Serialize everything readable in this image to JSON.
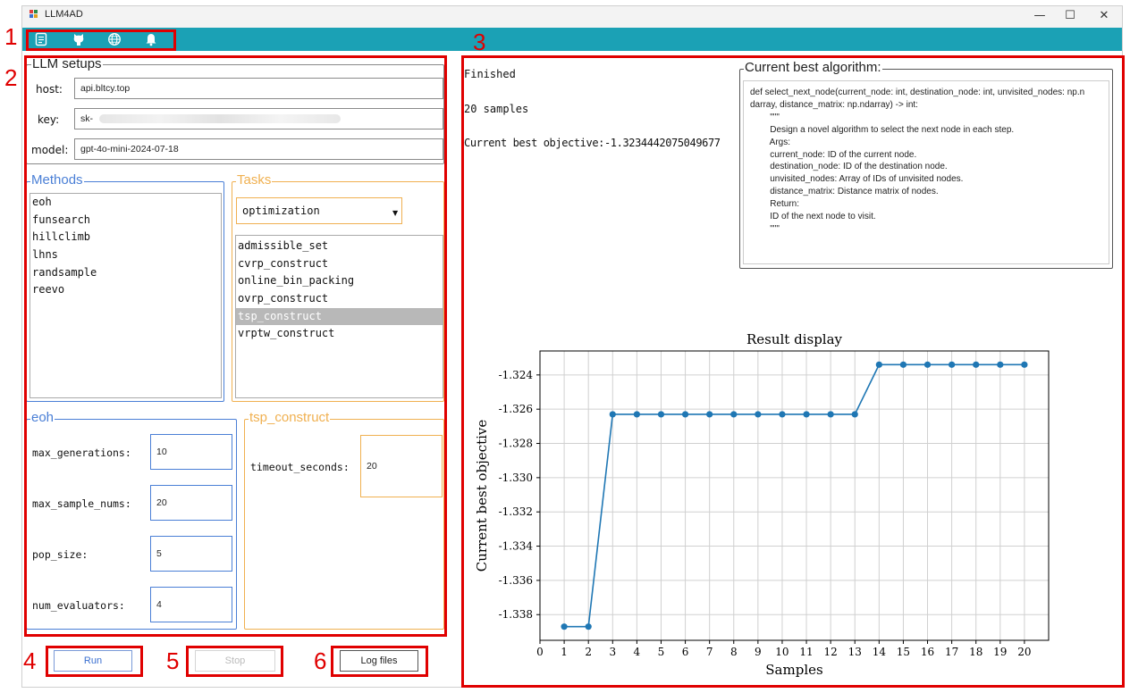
{
  "window": {
    "title": "LLM4AD",
    "controls": {
      "minimize": "—",
      "maximize": "☐",
      "close": "✕"
    }
  },
  "toolbar": {
    "icons": [
      "document-icon",
      "github-icon",
      "globe-icon",
      "bell-icon"
    ]
  },
  "annotations": {
    "n1": "1",
    "n2": "2",
    "n3": "3",
    "n4": "4",
    "n5": "5",
    "n6": "6"
  },
  "llm_setups": {
    "title": "LLM setups",
    "host_label": "host:",
    "host_value": "api.bltcy.top",
    "key_label": "key:",
    "key_value": "sk-",
    "model_label": "model:",
    "model_value": "gpt-4o-mini-2024-07-18"
  },
  "methods": {
    "title": "Methods",
    "items": [
      "eoh",
      "funsearch",
      "hillclimb",
      "lhns",
      "randsample",
      "reevo"
    ]
  },
  "tasks": {
    "title": "Tasks",
    "category": "optimization",
    "items": [
      "admissible_set",
      "cvrp_construct",
      "online_bin_packing",
      "ovrp_construct",
      "tsp_construct",
      "vrptw_construct"
    ],
    "selected": "tsp_construct"
  },
  "method_params": {
    "title": "eoh",
    "params": [
      {
        "label": "max_generations:",
        "value": "10"
      },
      {
        "label": "max_sample_nums:",
        "value": "20"
      },
      {
        "label": "pop_size:",
        "value": "5"
      },
      {
        "label": "num_evaluators:",
        "value": "4"
      }
    ]
  },
  "task_params": {
    "title": "tsp_construct",
    "params": [
      {
        "label": "timeout_seconds:",
        "value": "20"
      }
    ]
  },
  "buttons": {
    "run": "Run",
    "stop": "Stop",
    "log_files": "Log files"
  },
  "status": {
    "state": "Finished",
    "samples": "20 samples",
    "best_objective": "Current best objective:-1.3234442075049677"
  },
  "best_algorithm": {
    "title": "Current best algorithm:",
    "code_lines": [
      "def select_next_node(current_node: int, destination_node: int, unvisited_nodes: np.n",
      "darray, distance_matrix: np.ndarray) -> int:",
      "        \"\"\"",
      "        Design a novel algorithm to select the next node in each step.",
      "",
      "        Args:",
      "        current_node: ID of the current node.",
      "        destination_node: ID of the destination node.",
      "        unvisited_nodes: Array of IDs of unvisited nodes.",
      "        distance_matrix: Distance matrix of nodes.",
      "",
      "        Return:",
      "        ID of the next node to visit.",
      "        \"\"\""
    ]
  },
  "colors": {
    "toolbar": "#1ba1b5",
    "blue_group": "#4a7fd6",
    "orange_group": "#f0b050",
    "line": "#1f77b4",
    "annotation": "#e00000",
    "selected_row": "#b8b8b8"
  },
  "chart_data": {
    "type": "line",
    "title": "Result display",
    "xlabel": "Samples",
    "ylabel": "Current best objective",
    "x": [
      1,
      2,
      3,
      4,
      5,
      6,
      7,
      8,
      9,
      10,
      11,
      12,
      13,
      14,
      15,
      16,
      17,
      18,
      19,
      20
    ],
    "y": [
      -1.3387,
      -1.3387,
      -1.3263,
      -1.3263,
      -1.3263,
      -1.3263,
      -1.3263,
      -1.3263,
      -1.3263,
      -1.3263,
      -1.3263,
      -1.3263,
      -1.3263,
      -1.3234,
      -1.3234,
      -1.3234,
      -1.3234,
      -1.3234,
      -1.3234,
      -1.3234
    ],
    "xticks": [
      0,
      1,
      2,
      3,
      4,
      5,
      6,
      7,
      8,
      9,
      10,
      11,
      12,
      13,
      14,
      15,
      16,
      17,
      18,
      19,
      20
    ],
    "yticks": [
      -1.338,
      -1.336,
      -1.334,
      -1.332,
      -1.33,
      -1.328,
      -1.326,
      -1.324
    ],
    "ytick_labels": [
      "-1.338",
      "-1.336",
      "-1.334",
      "-1.332",
      "-1.330",
      "-1.328",
      "-1.326",
      "-1.324"
    ],
    "xlim": [
      0,
      21
    ],
    "ylim": [
      -1.3395,
      -1.3226
    ],
    "grid": true,
    "marker": "circle"
  }
}
